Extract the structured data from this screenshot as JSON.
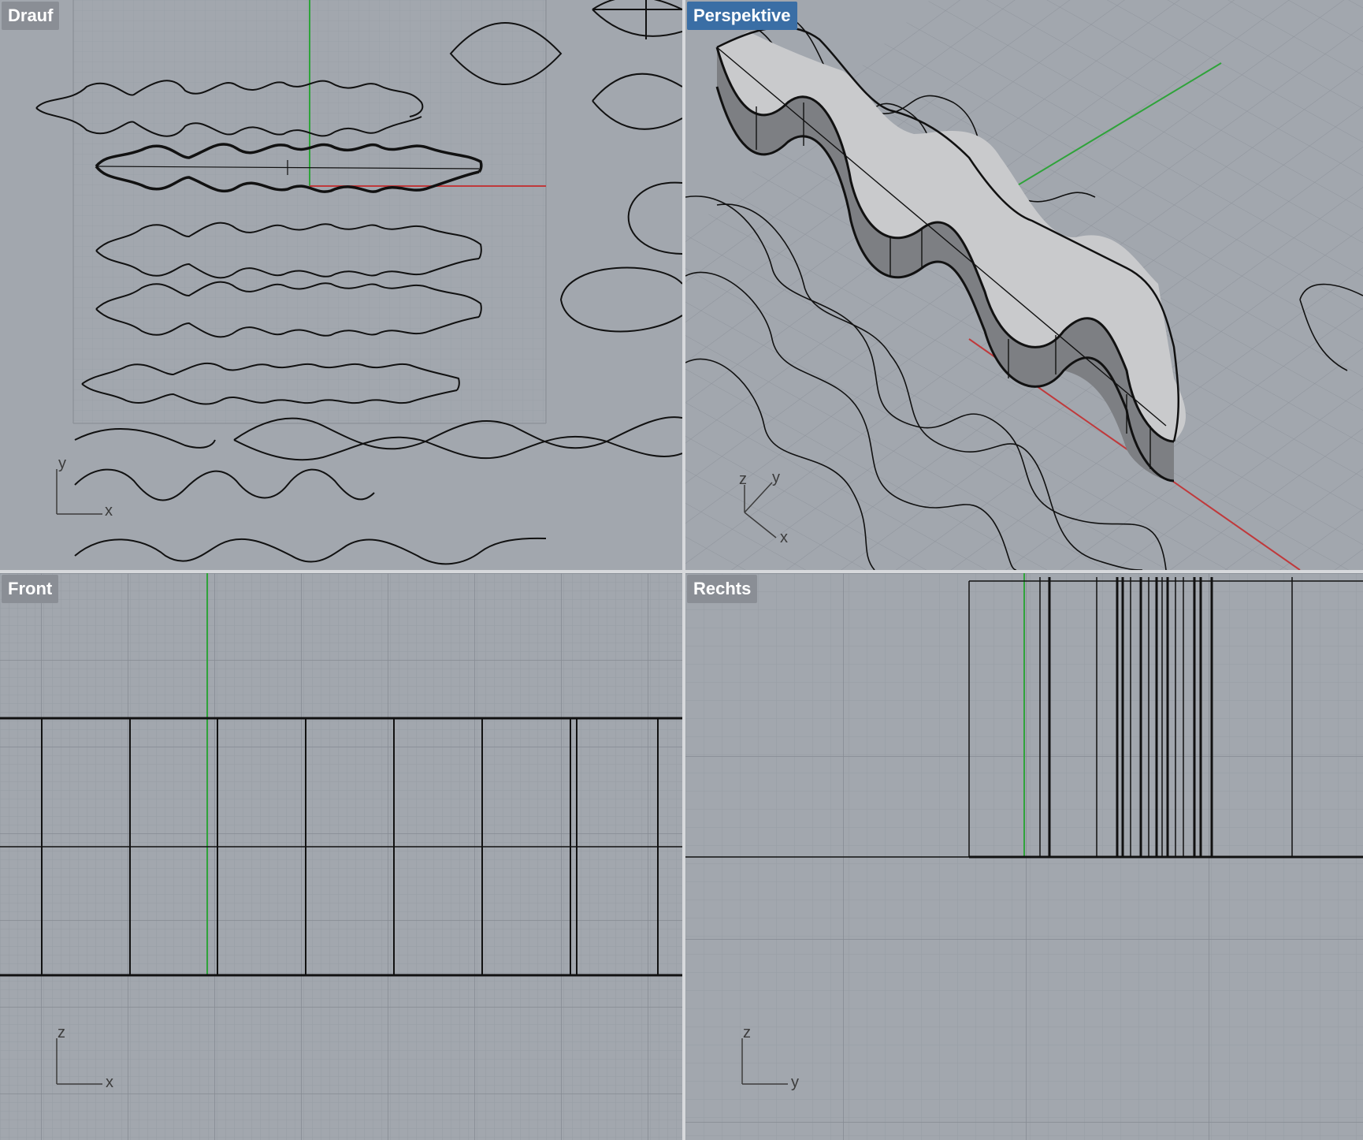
{
  "viewports": {
    "top": {
      "title": "Drauf",
      "axis_h": "x",
      "axis_v": "y",
      "active": false
    },
    "persp": {
      "title": "Perspektive",
      "axis_h": "x",
      "axis_v": "y",
      "axis_z": "z",
      "active": true
    },
    "front": {
      "title": "Front",
      "axis_h": "x",
      "axis_v": "z",
      "active": false
    },
    "right": {
      "title": "Rechts",
      "axis_h": "y",
      "axis_v": "z",
      "active": false
    }
  },
  "colors": {
    "viewport_bg": "#a2a7ae",
    "grid_minor": "#959aa2",
    "grid_major": "#858a92",
    "x_axis": "#c0393b",
    "y_axis": "#2fa33a",
    "active_title": "#3a6ea5",
    "inactive_title": "#8a8e95",
    "surface": "#c9c9c9",
    "curve": "#111111"
  }
}
